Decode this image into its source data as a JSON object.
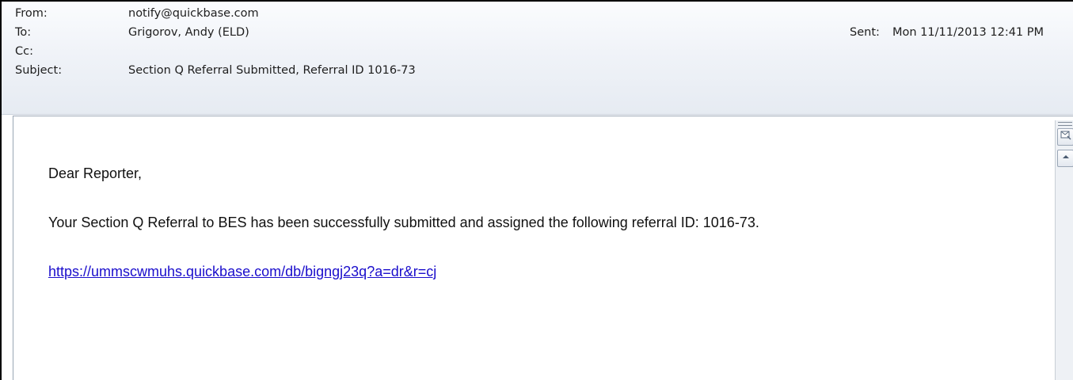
{
  "header": {
    "from_label": "From:",
    "from_value": "notify@quickbase.com",
    "to_label": "To:",
    "to_value": "Grigorov, Andy (ELD)",
    "cc_label": "Cc:",
    "cc_value": "",
    "subject_label": "Subject:",
    "subject_value": "Section Q Referral Submitted, Referral ID 1016-73",
    "sent_label": "Sent:",
    "sent_value": "Mon 11/11/2013 12:41 PM"
  },
  "body": {
    "greeting": "Dear Reporter,",
    "message": "Your Section Q Referral to BES has been successfully submitted and assigned the following referral ID: 1016-73.",
    "link": "https://ummscwmuhs.quickbase.com/db/bigngj23q?a=dr&r=cj"
  },
  "scrollbar": {
    "top_icon": "message-icon",
    "up_icon": "scroll-up-arrow-icon"
  },
  "colors": {
    "link": "#1a0dcc",
    "header_bg": "#eef2f7",
    "frame_border": "#000000"
  }
}
